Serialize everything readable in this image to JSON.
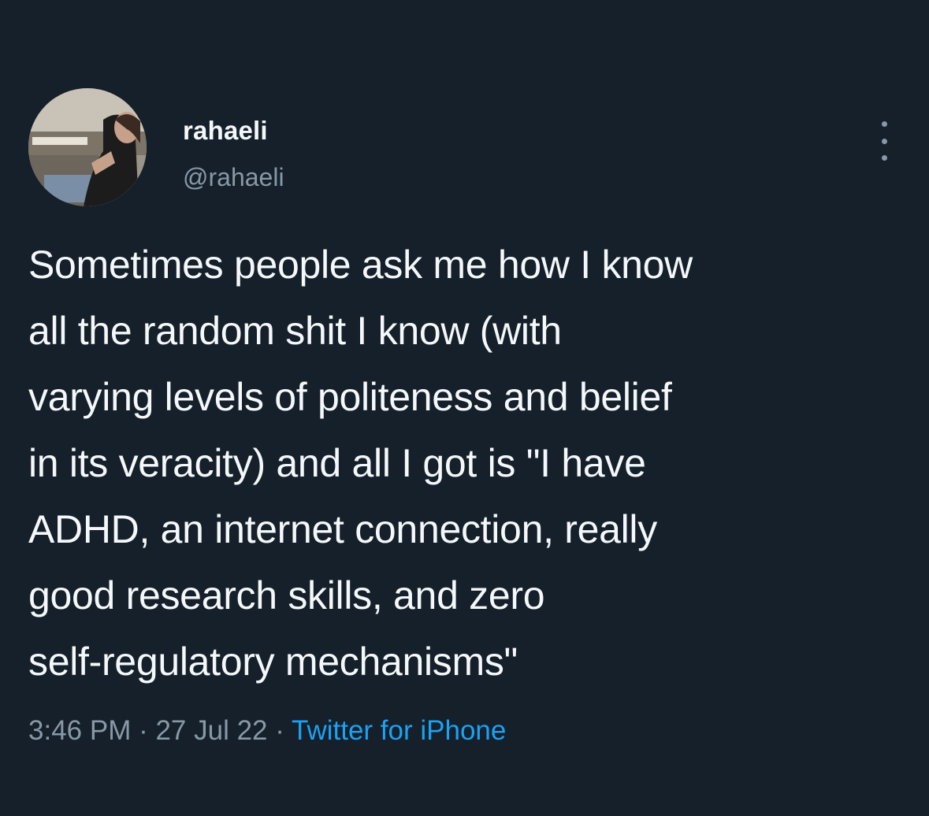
{
  "tweet": {
    "author": {
      "display_name": "rahaeli",
      "handle": "@rahaeli"
    },
    "more_icon": "more-vertical-icon",
    "text_lines": [
      "Sometimes people ask me how I know",
      "all the random shit I know (with",
      "varying levels of politeness and belief",
      "in its veracity) and all I got is \"I have",
      "ADHD, an internet connection, really",
      "good research skills, and zero",
      "self-regulatory mechanisms\""
    ],
    "meta": {
      "time": "3:46 PM",
      "separator": " · ",
      "date": "27 Jul 22",
      "source": "Twitter for iPhone"
    }
  },
  "colors": {
    "background": "#15202b",
    "text": "#f5f8fa",
    "secondary": "#8899a6",
    "link": "#1da1f2"
  }
}
